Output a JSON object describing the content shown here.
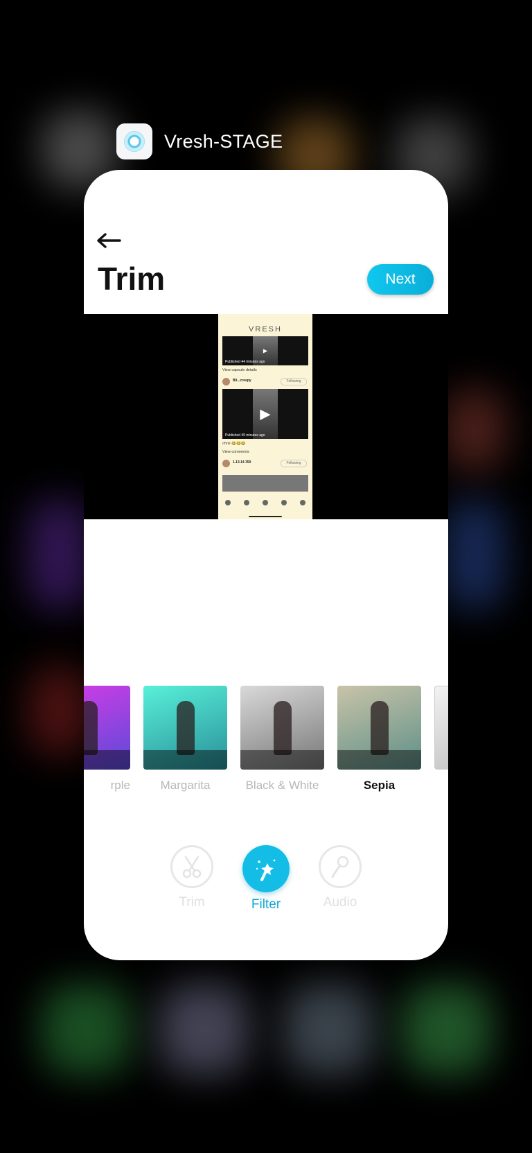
{
  "switcher": {
    "app_name": "Vresh-STAGE"
  },
  "header": {
    "title": "Trim",
    "next_label": "Next"
  },
  "preview": {
    "brand": "VRESH",
    "post1": {
      "caption": "Published 44 minutes ago",
      "link": "View capsule details"
    },
    "user1": {
      "name": "Bil...creepy",
      "follow": "Following"
    },
    "post2": {
      "caption": "Published 49 minutes ago",
      "comment": "chris 😂😂😂",
      "link": "View comments"
    },
    "user2": {
      "name": "1.13.14 350",
      "follow": "Following"
    }
  },
  "filters": [
    {
      "label": "rple",
      "colors": [
        "#d63ce6",
        "#5a4ad8"
      ]
    },
    {
      "label": "Margarita",
      "colors": [
        "#58f0d8",
        "#2a8f9a"
      ]
    },
    {
      "label": "Black & White",
      "colors": [
        "#d9d9d9",
        "#777777"
      ]
    },
    {
      "label": "Sepia",
      "colors": [
        "#c9c3a8",
        "#5d8f88"
      ],
      "selected": true
    },
    {
      "label": "",
      "colors": [
        "#f2f2f2",
        "#bdbdbd"
      ]
    }
  ],
  "tools": {
    "trim": "Trim",
    "filter": "Filter",
    "audio": "Audio"
  },
  "colors": {
    "accent": "#14bde6"
  }
}
